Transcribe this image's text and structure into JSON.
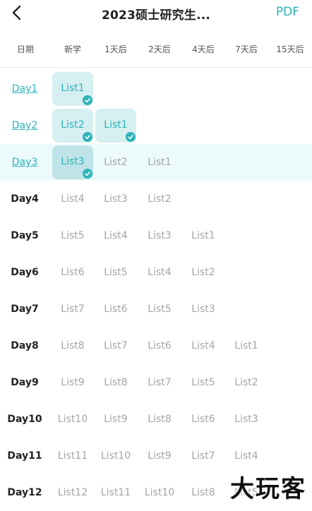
{
  "header": {
    "title": "2023硕士研究生...",
    "pdf_label": "PDF"
  },
  "columns": [
    "日期",
    "新学",
    "1天后",
    "2天后",
    "4天后",
    "7天后",
    "15天后"
  ],
  "rows": [
    {
      "day": "Day1",
      "cells": [
        "List1",
        "",
        "",
        "",
        "",
        ""
      ]
    },
    {
      "day": "Day2",
      "cells": [
        "List2",
        "List1",
        "",
        "",
        "",
        ""
      ]
    },
    {
      "day": "Day3",
      "cells": [
        "List3",
        "List2",
        "List1",
        "",
        "",
        ""
      ]
    },
    {
      "day": "Day4",
      "cells": [
        "List4",
        "List3",
        "List2",
        "",
        "",
        ""
      ]
    },
    {
      "day": "Day5",
      "cells": [
        "List5",
        "List4",
        "List3",
        "List1",
        "",
        ""
      ]
    },
    {
      "day": "Day6",
      "cells": [
        "List6",
        "List5",
        "List4",
        "List2",
        "",
        ""
      ]
    },
    {
      "day": "Day7",
      "cells": [
        "List7",
        "List6",
        "List5",
        "List3",
        "",
        ""
      ]
    },
    {
      "day": "Day8",
      "cells": [
        "List8",
        "List7",
        "List6",
        "List4",
        "List1",
        ""
      ]
    },
    {
      "day": "Day9",
      "cells": [
        "List9",
        "List8",
        "List7",
        "List5",
        "List2",
        ""
      ]
    },
    {
      "day": "Day10",
      "cells": [
        "List10",
        "List9",
        "List8",
        "List6",
        "List3",
        ""
      ]
    },
    {
      "day": "Day11",
      "cells": [
        "List11",
        "List10",
        "List9",
        "List7",
        "List4",
        ""
      ]
    },
    {
      "day": "Day12",
      "cells": [
        "List12",
        "List11",
        "List10",
        "List8",
        "List5",
        ""
      ]
    }
  ],
  "completed": {
    "Day1": [
      0
    ],
    "Day2": [
      0,
      1
    ],
    "Day3": [
      0
    ]
  },
  "studied_days": [
    "Day1",
    "Day2",
    "Day3"
  ],
  "current_day": "Day3",
  "watermark": "大玩客",
  "colors": {
    "accent": "#2bb3b8",
    "done_bg": "#d6eff1",
    "today_row_bg": "#ecfafb",
    "pending_text": "#a5a5a5"
  }
}
